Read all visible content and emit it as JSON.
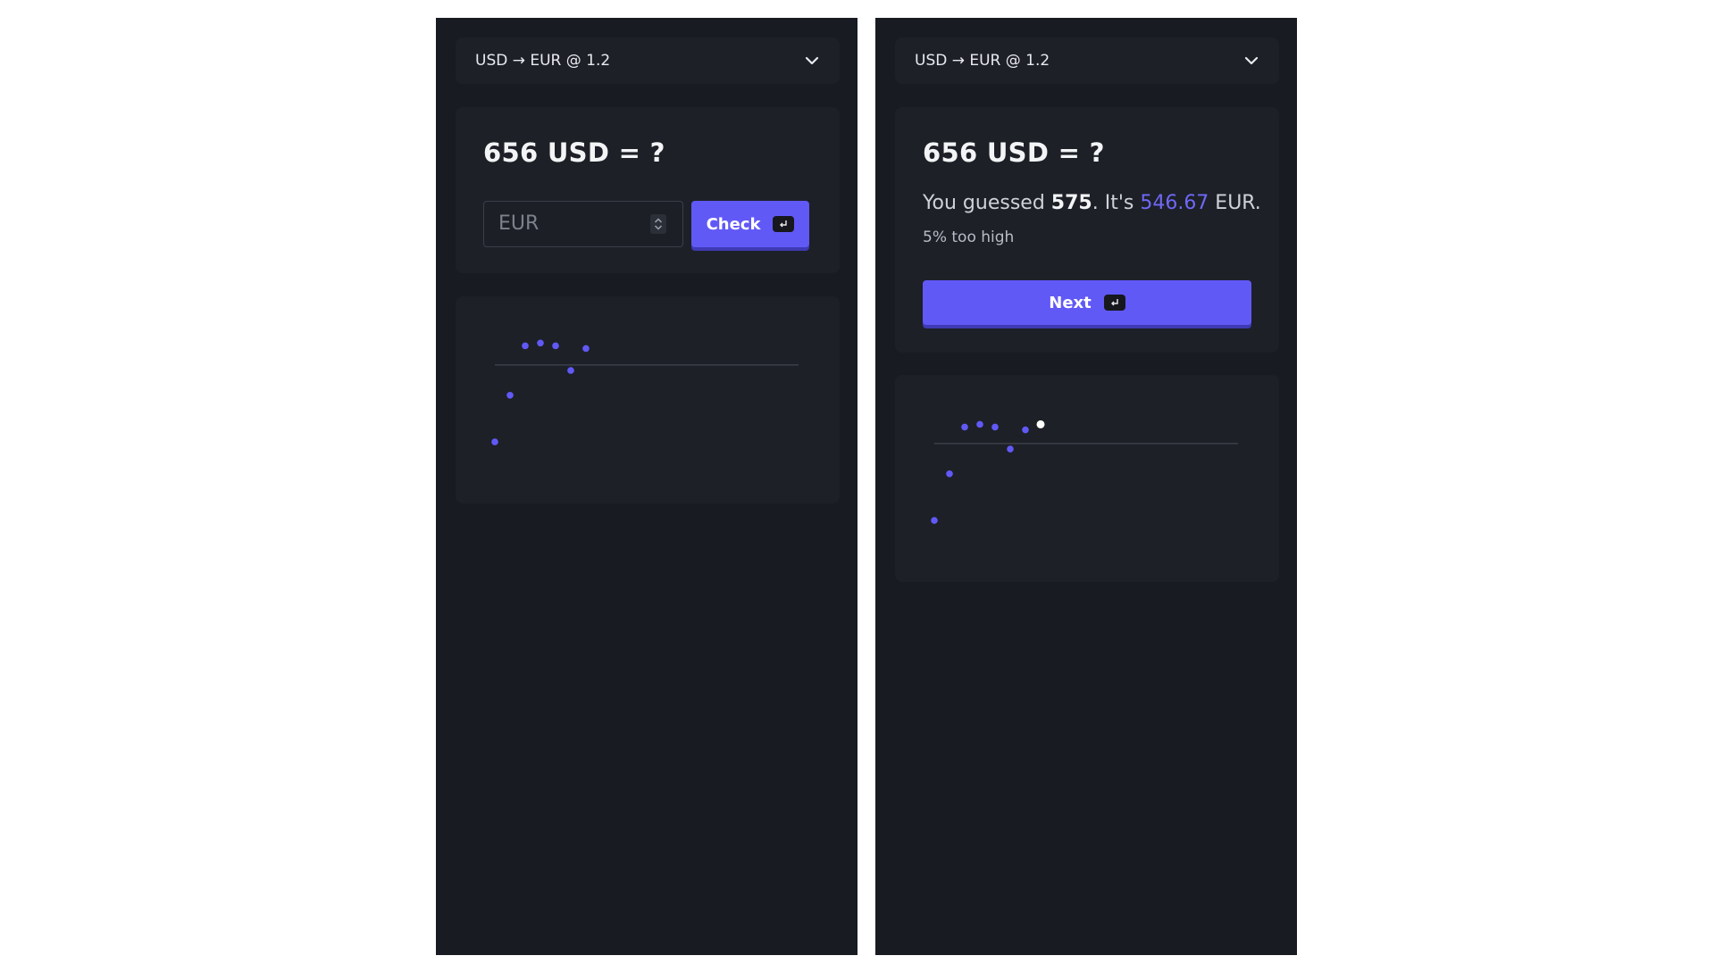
{
  "colors": {
    "accent": "#6159f6",
    "answer": "#6f68f6",
    "background": "#181b21",
    "panel": "#1d2027",
    "highlight": "#ffffff"
  },
  "screens": [
    {
      "dropdown": {
        "label": "USD → EUR @ 1.2",
        "icon": "chevron-down-icon"
      },
      "question": "656 USD = ?",
      "input": {
        "placeholder": "EUR",
        "value": ""
      },
      "check_button": {
        "label": "Check",
        "shortcut_icon": "enter-key-icon"
      }
    },
    {
      "dropdown": {
        "label": "USD → EUR @ 1.2",
        "icon": "chevron-down-icon"
      },
      "question": "656 USD = ?",
      "result": {
        "prefix": "You guessed ",
        "guess": "575",
        "middle": ". It's ",
        "answer": "546.67",
        "suffix": " EUR."
      },
      "diff_text": "5% too high",
      "next_button": {
        "label": "Next",
        "shortcut_icon": "enter-key-icon"
      }
    }
  ],
  "chart_data": [
    {
      "type": "scatter",
      "baseline": 0,
      "ylim": [
        -0.4,
        0.12
      ],
      "x": [
        1,
        2,
        3,
        4,
        5,
        6,
        7
      ],
      "y": [
        -0.28,
        -0.11,
        0.07,
        0.08,
        0.07,
        -0.02,
        0.06
      ],
      "highlight_index": null
    },
    {
      "type": "scatter",
      "baseline": 0,
      "ylim": [
        -0.4,
        0.12
      ],
      "x": [
        1,
        2,
        3,
        4,
        5,
        6,
        7,
        8
      ],
      "y": [
        -0.28,
        -0.11,
        0.06,
        0.07,
        0.06,
        -0.02,
        0.05,
        0.07
      ],
      "highlight_index": 7
    }
  ]
}
